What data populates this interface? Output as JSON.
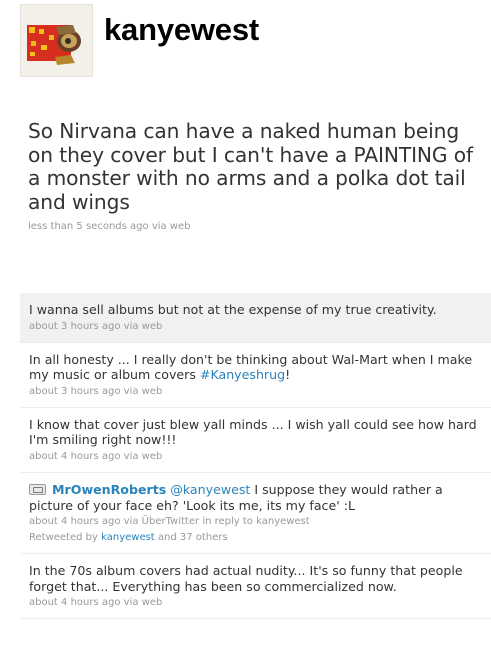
{
  "profile": {
    "screen_name": "kanyewest",
    "avatar_icon": "painting-avatar-icon"
  },
  "featured": {
    "text": "So Nirvana can have a naked human being on they cover but I can't have a PAINTING of a monster with no arms and a polka dot tail and wings",
    "time": "less than 5 seconds ago",
    "via": "via",
    "source": "web"
  },
  "tweets": [
    {
      "text": "I wanna sell albums but not at the expense of my true creativity.",
      "time": "about 3 hours ago",
      "via": "via",
      "source": "web"
    },
    {
      "text_before": "In all honesty ... I really don't be thinking about Wal-Mart when I make my music or album covers ",
      "hashtag": "#Kanyeshrug",
      "text_after": "!",
      "time": "about 3 hours ago",
      "via": "via",
      "source": "web"
    },
    {
      "text": "I know that cover just blew yall minds ... I wish yall could see how hard I'm smiling right now!!!",
      "time": "about 4 hours ago",
      "via": "via",
      "source": "web"
    },
    {
      "author": "MrOwenRoberts",
      "mention": "@kanyewest",
      "text": " I suppose they would rather a picture of your face eh? 'Look its me, its my face' :L",
      "time": "about 4 hours ago",
      "via": "via",
      "source": "ÜberTwitter",
      "reply_prefix": "in reply to",
      "reply_to": "kanyewest",
      "retweeted_by_label": "Retweeted by",
      "retweeted_by": "kanyewest",
      "retweeted_others": "and 37 others"
    },
    {
      "text": "In the 70s album covers had actual nudity... It's so funny that people forget that... Everything has been so commercialized now.",
      "time": "about 4 hours ago",
      "via": "via",
      "source": "web"
    }
  ],
  "colors": {
    "link": "#2a83b9",
    "meta": "#999999",
    "highlight_bg": "#f1f1f1"
  }
}
